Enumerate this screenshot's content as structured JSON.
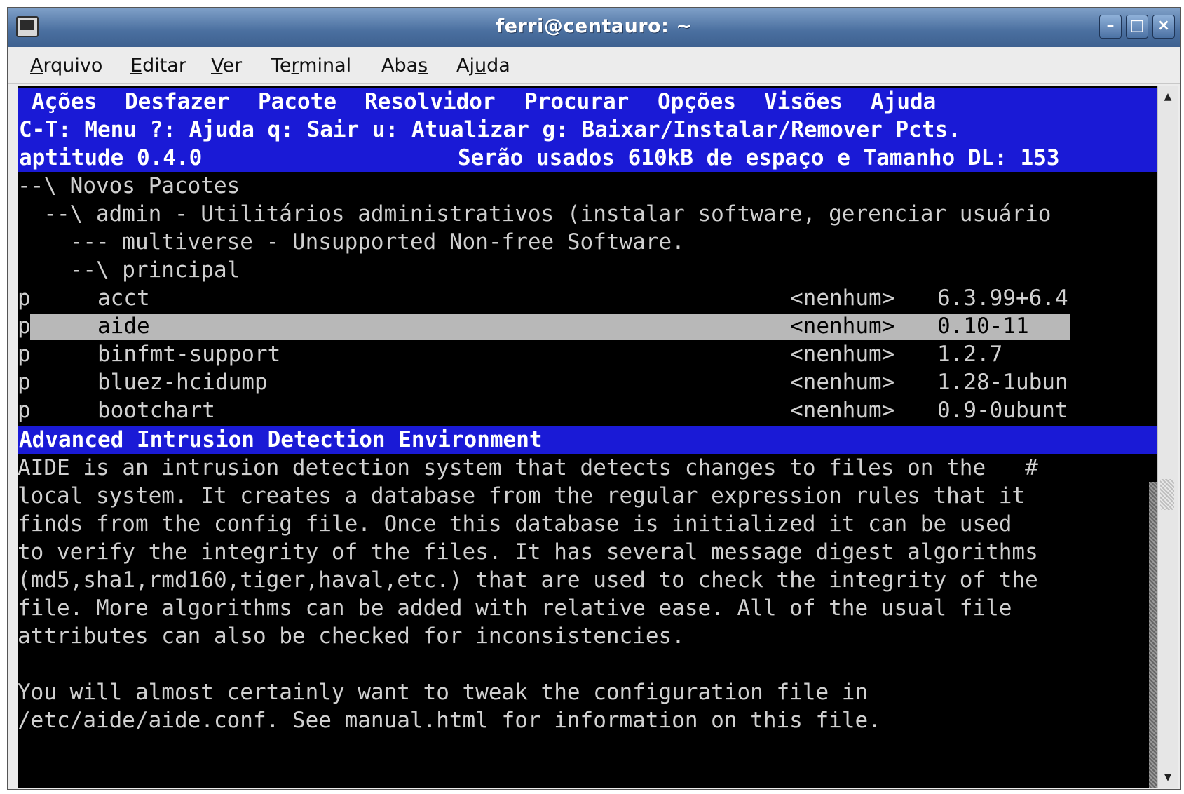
{
  "window": {
    "title": "ferri@centauro: ~"
  },
  "menubar": {
    "items": [
      {
        "label": "Arquivo",
        "u": "A",
        "rest": "rquivo"
      },
      {
        "label": "Editar",
        "u": "E",
        "rest": "ditar"
      },
      {
        "label": "Ver",
        "u": "V",
        "rest": "er"
      },
      {
        "label": "Terminal",
        "pre": "Te",
        "u": "r",
        "rest": "minal"
      },
      {
        "label": "Abas",
        "pre": "Aba",
        "u": "s",
        "rest": ""
      },
      {
        "label": "Ajuda",
        "pre": "Aj",
        "u": "u",
        "rest": "da"
      }
    ]
  },
  "aptitude": {
    "menu": [
      "Ações",
      "Desfazer",
      "Pacote",
      "Resolvidor",
      "Procurar",
      "Opções",
      "Visões",
      "Ajuda"
    ],
    "hint": "C-T: Menu ?: Ajuda q: Sair u: Atualizar g: Baixar/Instalar/Remover Pcts.",
    "status_left": "aptitude 0.4.0",
    "status_right": "Serão usados 610kB de espaço e Tamanho DL: 153",
    "tree": [
      "--\\ Novos Pacotes",
      "  --\\ admin - Utilitários administrativos (instalar software, gerenciar usuário",
      "    --- multiverse - Unsupported Non-free Software.",
      "    --\\ principal"
    ],
    "packages": [
      {
        "flag": "p",
        "name": "acct",
        "installed": "<nenhum>",
        "version": "6.3.99+6.4"
      },
      {
        "flag": "p",
        "name": "aide",
        "installed": "<nenhum>",
        "version": "0.10-11",
        "selected": true
      },
      {
        "flag": "p",
        "name": "binfmt-support",
        "installed": "<nenhum>",
        "version": "1.2.7"
      },
      {
        "flag": "p",
        "name": "bluez-hcidump",
        "installed": "<nenhum>",
        "version": "1.28-1ubun"
      },
      {
        "flag": "p",
        "name": "bootchart",
        "installed": "<nenhum>",
        "version": "0.9-0ubunt"
      }
    ],
    "description_title": "Advanced Intrusion Detection Environment",
    "description": [
      "AIDE is an intrusion detection system that detects changes to files on the   #",
      "local system. It creates a database from the regular expression rules that it",
      "finds from the config file. Once this database is initialized it can be used",
      "to verify the integrity of the files. It has several message digest algorithms",
      "(md5,sha1,rmd160,tiger,haval,etc.) that are used to check the integrity of the",
      "file. More algorithms can be added with relative ease. All of the usual file",
      "attributes can also be checked for inconsistencies.",
      "",
      "You will almost certainly want to tweak the configuration file in",
      "/etc/aide/aide.conf. See manual.html for information on this file."
    ]
  }
}
